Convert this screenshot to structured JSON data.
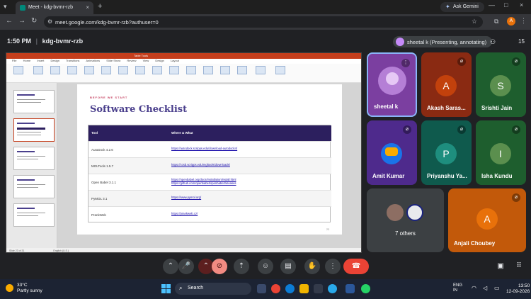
{
  "browser": {
    "tab_title": "Meet - kdg-bvmr-rzb",
    "url": "meet.google.com/kdg-bvmr-rzb?authuser=0",
    "gemini_label": "Ask Gemini",
    "profile_initial": "A"
  },
  "meet": {
    "time": "1:50 PM",
    "meeting_code": "kdg-bvmr-rzb",
    "presenter_chip": "sheetal k (Presenting, annotating)",
    "participant_count": "15"
  },
  "slide": {
    "ppt_title_bar": "Table Tools",
    "menu": [
      "File",
      "Home",
      "Insert",
      "Design",
      "Transitions",
      "Animations",
      "Slide Show",
      "Review",
      "View",
      "Design",
      "Layout"
    ],
    "kicker": "BEFORE WE START",
    "title": "Software Checklist",
    "table_headers": [
      "Tool",
      "Where & What"
    ],
    "rows": [
      {
        "tool": "AutoDock 4.2.6",
        "url": "https://autodock.scripps.edu/download-autodock4/"
      },
      {
        "tool": "MGLTools 1.5.7",
        "url": "https://ccsb.scripps.edu/mgltools/downloads/"
      },
      {
        "tool": "Open Babel 3.1.1",
        "url": "https://openbabel.org/docs/Installation/install.html",
        "url2": "https://github.com/openbabel/openbabel/releases"
      },
      {
        "tool": "PyMOL 3.1",
        "url": "https://www.pymol.org/"
      },
      {
        "tool": "PrankWeb",
        "url": "https://prankweb.cz/"
      }
    ],
    "page_number": "23",
    "status_left": "Slide 23 of 31",
    "status_right": "English (U.S.)"
  },
  "participants": [
    {
      "name": "sheetal k",
      "initial": "",
      "color": "#7b3fa0"
    },
    {
      "name": "Akash Saras...",
      "initial": "A",
      "color": "#8a2a12"
    },
    {
      "name": "Srishti Jain",
      "initial": "S",
      "color": "#1e5e2e"
    },
    {
      "name": "Amit Kumar",
      "initial": "",
      "color": "#4e2a8c"
    },
    {
      "name": "Priyanshu Ya...",
      "initial": "P",
      "color": "#0f5a4d"
    },
    {
      "name": "Isha Kundu",
      "initial": "I",
      "color": "#1e5e2e"
    },
    {
      "name": "7 others",
      "initial": "",
      "color": "#3c4043"
    },
    {
      "name": "Anjali Choubey",
      "initial": "A",
      "color": "#c2590a"
    }
  ],
  "taskbar": {
    "temperature": "33°C",
    "weather": "Partly sunny",
    "search_label": "Search",
    "lang1": "ENG",
    "lang2": "IN",
    "clock_time": "13:50",
    "clock_date": "12-09-2026"
  },
  "colors": {
    "accent_ppt": "#c43e1c",
    "slide_title": "#4a3f8c",
    "table_header": "#2c1f5e",
    "end_call": "#ea4335"
  }
}
